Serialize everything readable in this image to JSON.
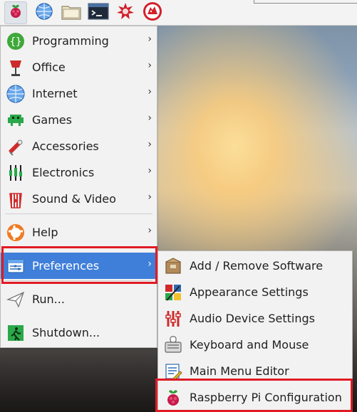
{
  "panel": {
    "icons": [
      "raspberry-icon",
      "web-browser-icon",
      "file-manager-icon",
      "terminal-icon",
      "burst-icon",
      "wolf-icon"
    ]
  },
  "main_menu": {
    "items": [
      {
        "label": "Programming",
        "icon": "programming-icon",
        "has_submenu": true
      },
      {
        "label": "Office",
        "icon": "office-icon",
        "has_submenu": true
      },
      {
        "label": "Internet",
        "icon": "internet-icon",
        "has_submenu": true
      },
      {
        "label": "Games",
        "icon": "games-icon",
        "has_submenu": true
      },
      {
        "label": "Accessories",
        "icon": "accessories-icon",
        "has_submenu": true
      },
      {
        "label": "Electronics",
        "icon": "electronics-icon",
        "has_submenu": true
      },
      {
        "label": "Sound & Video",
        "icon": "sound-video-icon",
        "has_submenu": true
      },
      {
        "label": "Help",
        "icon": "help-icon",
        "has_submenu": true
      },
      {
        "label": "Preferences",
        "icon": "preferences-icon",
        "has_submenu": true,
        "selected": true
      },
      {
        "label": "Run...",
        "icon": "run-icon",
        "has_submenu": false
      },
      {
        "label": "Shutdown...",
        "icon": "shutdown-icon",
        "has_submenu": false
      }
    ],
    "chevron": "›"
  },
  "preferences_submenu": {
    "items": [
      {
        "label": "Add / Remove Software",
        "icon": "package-icon"
      },
      {
        "label": "Appearance Settings",
        "icon": "appearance-icon"
      },
      {
        "label": "Audio Device Settings",
        "icon": "audio-icon"
      },
      {
        "label": "Keyboard and Mouse",
        "icon": "keyboard-mouse-icon"
      },
      {
        "label": "Main Menu Editor",
        "icon": "menu-editor-icon"
      },
      {
        "label": "Raspberry Pi Configuration",
        "icon": "raspberry-icon",
        "highlighted_box": true
      }
    ]
  },
  "colors": {
    "selection": "#3f7fda",
    "highlight_box": "#e01b24"
  }
}
